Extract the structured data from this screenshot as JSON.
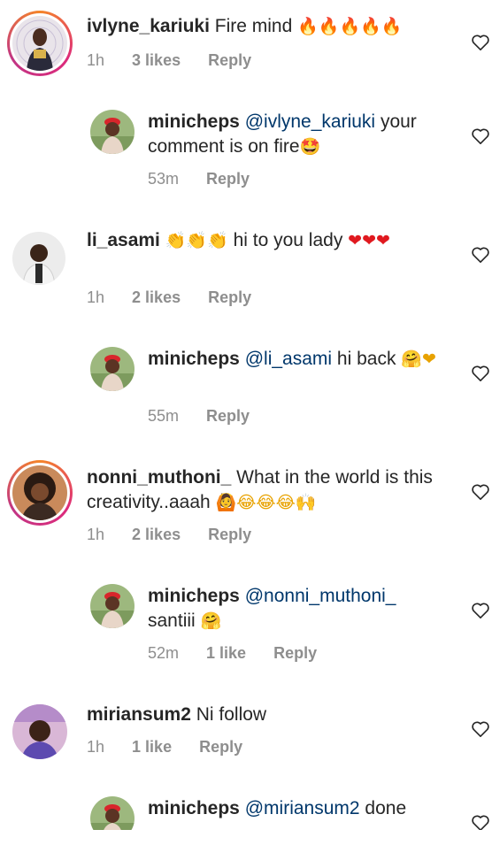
{
  "comments": [
    {
      "username": "ivlyne_kariuki",
      "text": "Fire mind",
      "emojis": "🔥🔥🔥🔥🔥",
      "time": "1h",
      "likes": "3 likes",
      "reply": "Reply",
      "has_story_ring": true
    },
    {
      "username": "minicheps",
      "mention": "@ivlyne_kariuki",
      "text": "your comment is on fire",
      "emojis": "🤩",
      "time": "53m",
      "likes": "",
      "reply": "Reply",
      "is_reply": true
    },
    {
      "username": "li_asami",
      "emojis_a": "👏👏👏",
      "text": "hi to you lady",
      "emojis": "❤❤❤",
      "time": "1h",
      "likes": "2 likes",
      "reply": "Reply"
    },
    {
      "username": "minicheps",
      "mention": "@li_asami",
      "text": "hi back",
      "emojis": "🤗❤",
      "time": "55m",
      "likes": "",
      "reply": "Reply",
      "is_reply": true
    },
    {
      "username": "nonni_muthoni_",
      "text": "What in the world is this creativity..aaah",
      "emojis": "🙆😂😂😂🙌",
      "time": "1h",
      "likes": "2 likes",
      "reply": "Reply",
      "has_story_ring": true
    },
    {
      "username": "minicheps",
      "mention": "@nonni_muthoni_",
      "text": "santiii",
      "emojis": "🤗",
      "time": "52m",
      "likes": "1 like",
      "reply": "Reply",
      "is_reply": true
    },
    {
      "username": "miriansum2",
      "text": "Ni follow",
      "time": "1h",
      "likes": "1 like",
      "reply": "Reply"
    },
    {
      "username": "minicheps",
      "mention": "@miriansum2",
      "text": "done",
      "time": "",
      "likes": "",
      "reply": "",
      "is_reply": true
    }
  ],
  "icons": {
    "like": "heart-outline-icon"
  }
}
